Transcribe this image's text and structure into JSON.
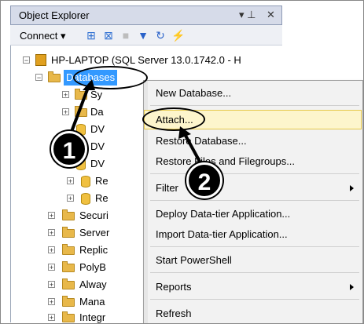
{
  "explorer": {
    "title": "Object Explorer",
    "pin": "↓ ȩ",
    "close": "✕"
  },
  "toolbar": {
    "connect_label": "Connect ▾"
  },
  "tree": {
    "server": "HP-LAPTOP (SQL Server 13.0.1742.0 - H",
    "databases": "Databases",
    "db_children": [
      "Sy",
      "Da",
      "DV",
      "DV",
      "DV",
      "Re",
      "Re"
    ],
    "folders": [
      "Securi",
      "Server",
      "Replic",
      "PolyB",
      "Alway",
      "Mana",
      "Integr"
    ]
  },
  "context_menu": {
    "items": [
      "New Database...",
      "Attach...",
      "Restore Database...",
      "Restore Files and Filegroups...",
      "Filter",
      "Deploy Data-tier Application...",
      "Import Data-tier Application...",
      "Start PowerShell",
      "Reports",
      "Refresh"
    ]
  },
  "annotations": {
    "step1": "1",
    "step2": "2"
  },
  "colors": {
    "selection": "#3399ff",
    "highlight": "#fdf5cc"
  }
}
